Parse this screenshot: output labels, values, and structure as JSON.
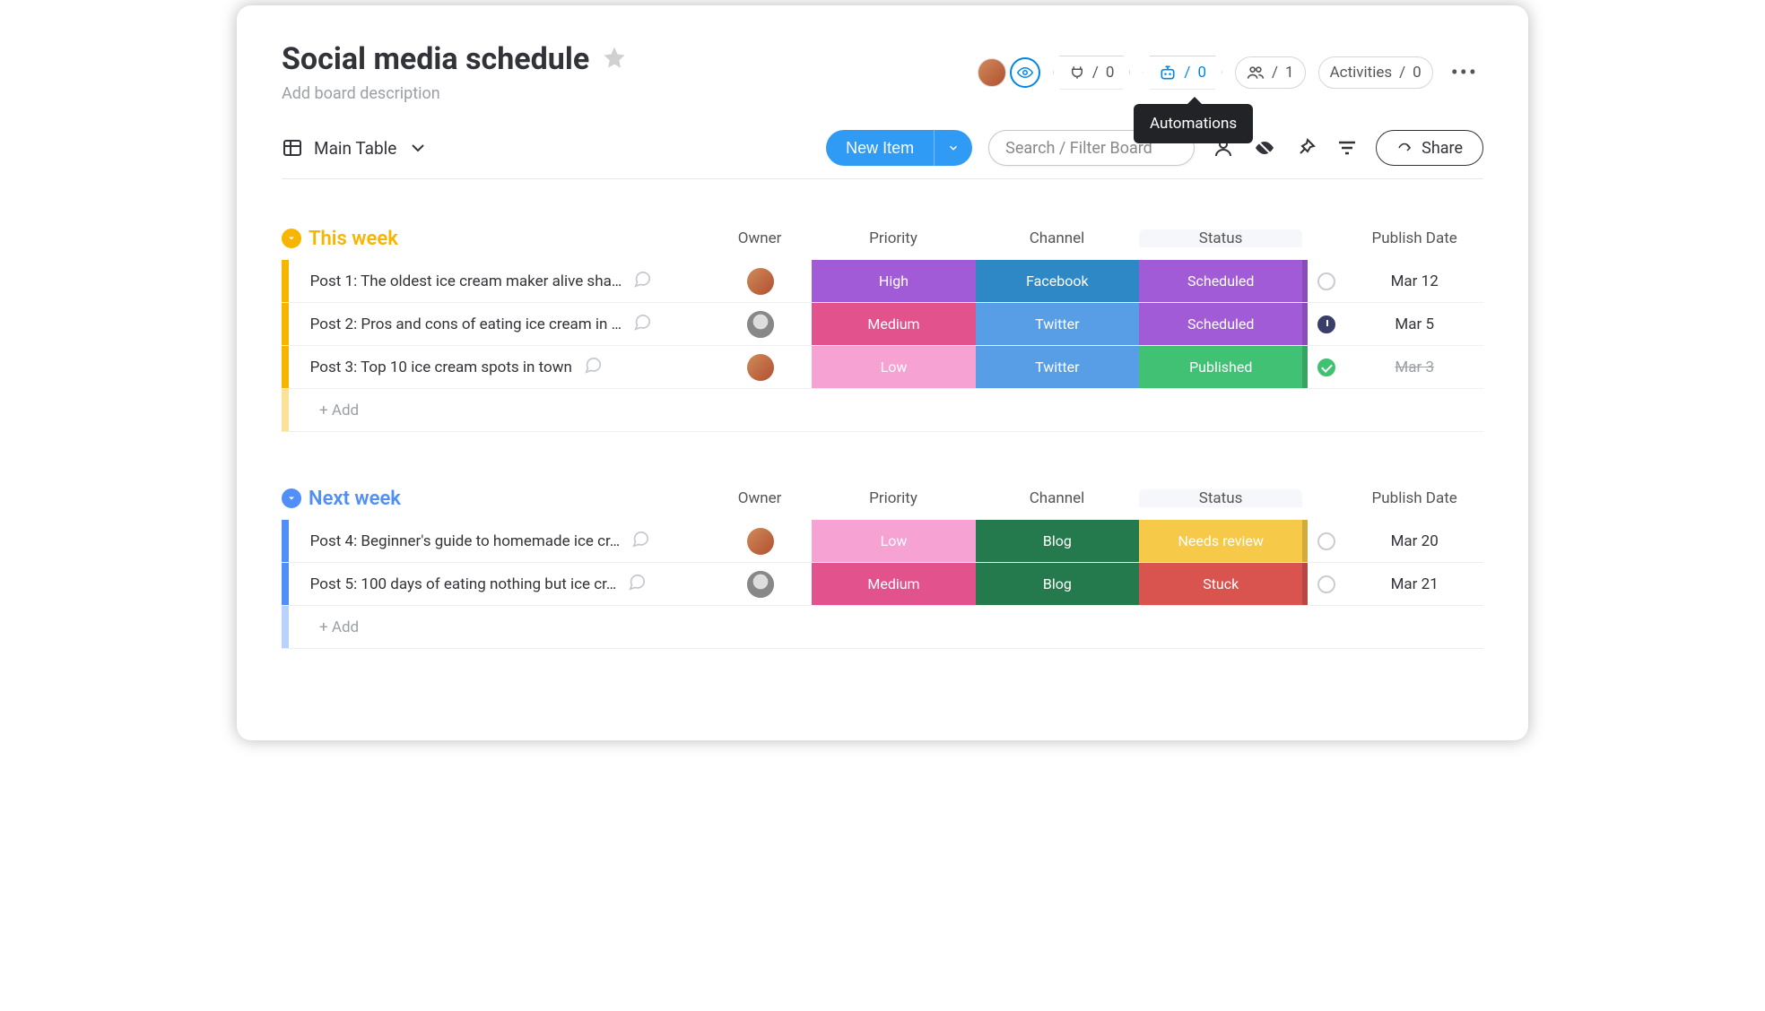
{
  "board": {
    "title": "Social media schedule",
    "description": "Add board description"
  },
  "header": {
    "integrations": {
      "count": "0",
      "sep": "/"
    },
    "automations": {
      "count": "0",
      "sep": "/",
      "tooltip": "Automations"
    },
    "members": {
      "count": "1",
      "sep": "/"
    },
    "activities": {
      "label": "Activities",
      "sep": "/",
      "count": "0"
    }
  },
  "toolbar": {
    "view": "Main Table",
    "new_item": "New Item",
    "search_placeholder": "Search / Filter Board",
    "share": "Share"
  },
  "columns": {
    "owner": "Owner",
    "priority": "Priority",
    "channel": "Channel",
    "status": "Status",
    "date": "Publish Date"
  },
  "colors": {
    "priority": {
      "High": "#a25bd7",
      "Medium": "#e2538d",
      "Low": "#f6a3d4"
    },
    "channel": {
      "Facebook": "#2f88c6",
      "Twitter": "#589ee6",
      "Blog": "#247a4d"
    },
    "status": {
      "Scheduled": "#a25bd7",
      "Published": "#41c173",
      "Needs review": "#f7c948",
      "Stuck": "#d9534f"
    },
    "group": {
      "this_week": "#f7b500",
      "next_week": "#4f8ff7"
    }
  },
  "groups": [
    {
      "id": "this_week",
      "title": "This week",
      "color": "#f7b500",
      "rows": [
        {
          "name": "Post 1: The oldest ice cream maker alive sha…",
          "owner": "color",
          "priority": "High",
          "channel": "Facebook",
          "status": "Scheduled",
          "check": "empty",
          "date": "Mar 12",
          "date_strike": false
        },
        {
          "name": "Post 2: Pros and cons of eating ice cream in …",
          "owner": "gray",
          "priority": "Medium",
          "channel": "Twitter",
          "status": "Scheduled",
          "check": "clock",
          "date": "Mar 5",
          "date_strike": false
        },
        {
          "name": "Post 3: Top 10 ice cream spots in town",
          "owner": "color",
          "priority": "Low",
          "channel": "Twitter",
          "status": "Published",
          "check": "done",
          "date": "Mar 3",
          "date_strike": true
        }
      ],
      "add": "+ Add"
    },
    {
      "id": "next_week",
      "title": "Next week",
      "color": "#4f8ff7",
      "rows": [
        {
          "name": "Post 4: Beginner's guide to homemade ice cr…",
          "owner": "color",
          "priority": "Low",
          "channel": "Blog",
          "status": "Needs review",
          "check": "empty",
          "date": "Mar 20",
          "date_strike": false
        },
        {
          "name": "Post 5: 100 days of eating nothing but ice cr…",
          "owner": "gray",
          "priority": "Medium",
          "channel": "Blog",
          "status": "Stuck",
          "check": "empty",
          "date": "Mar 21",
          "date_strike": false
        }
      ],
      "add": "+ Add"
    }
  ]
}
